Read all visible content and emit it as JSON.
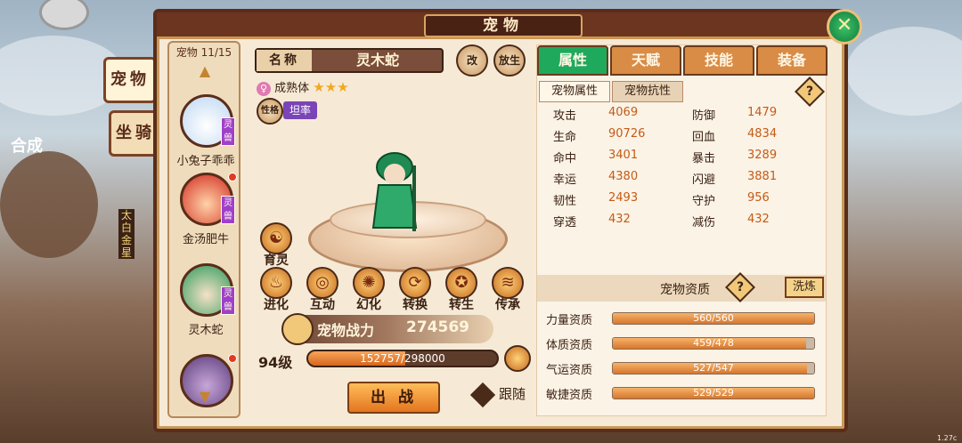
{
  "window": {
    "title": "宠物",
    "close_label": "✕"
  },
  "side_tabs": [
    {
      "label": "宠物"
    },
    {
      "label": "坐骑"
    }
  ],
  "pet_list": {
    "count_label": "宠物 11/15",
    "pets": [
      {
        "name": "小兔子乖乖",
        "badge": "灵兽"
      },
      {
        "name": "金汤肥牛",
        "badge": "灵兽"
      },
      {
        "name": "灵木蛇",
        "badge": "灵兽"
      },
      {
        "name": "",
        "badge": ""
      }
    ]
  },
  "pet_detail": {
    "name_label": "名称",
    "name": "灵木蛇",
    "rename_icon": "改",
    "release_icon": "放生",
    "maturity": "成熟体",
    "stars": "★★★",
    "nature_icon": "性格",
    "nature": "坦率",
    "spirit_skill": "育灵",
    "actions": [
      {
        "label": "进化"
      },
      {
        "label": "互动"
      },
      {
        "label": "幻化"
      },
      {
        "label": "转换"
      },
      {
        "label": "转生"
      },
      {
        "label": "传承"
      }
    ],
    "power_label": "宠物战力",
    "power_value": "274569",
    "level": "94级",
    "exp_text": "152757/298000",
    "exp_fraction": 0.513,
    "fight_button": "出 战",
    "follow_label": "跟随"
  },
  "right_panel": {
    "tabs": [
      {
        "label": "属性"
      },
      {
        "label": "天赋"
      },
      {
        "label": "技能"
      },
      {
        "label": "装备"
      }
    ],
    "subtabs": [
      {
        "label": "宠物属性"
      },
      {
        "label": "宠物抗性"
      }
    ],
    "help": "?",
    "stats": [
      {
        "n1": "攻击",
        "v1": "4069",
        "n2": "防御",
        "v2": "1479"
      },
      {
        "n1": "生命",
        "v1": "90726",
        "n2": "回血",
        "v2": "4834"
      },
      {
        "n1": "命中",
        "v1": "3401",
        "n2": "暴击",
        "v2": "3289"
      },
      {
        "n1": "幸运",
        "v1": "4380",
        "n2": "闪避",
        "v2": "3881"
      },
      {
        "n1": "韧性",
        "v1": "2493",
        "n2": "守护",
        "v2": "956"
      },
      {
        "n1": "穿透",
        "v1": "432",
        "n2": "减伤",
        "v2": "432"
      }
    ],
    "aptitude_title": "宠物资质",
    "wash_button": "洗炼",
    "aptitudes": [
      {
        "name": "力量资质",
        "text": "560/560",
        "fraction": 1.0
      },
      {
        "name": "体质资质",
        "text": "459/478",
        "fraction": 0.96
      },
      {
        "name": "气运资质",
        "text": "527/547",
        "fraction": 0.963
      },
      {
        "name": "敏捷资质",
        "text": "529/529",
        "fraction": 1.0
      }
    ]
  },
  "background": {
    "left_label": "合成",
    "sign": "太白金星"
  },
  "corner_text": "1.27c",
  "colors": {
    "accent_green": "#1fa95c",
    "tab_orange": "#d98c45",
    "frame_brown": "#5a2d1a",
    "value_orange": "#c65a16"
  }
}
